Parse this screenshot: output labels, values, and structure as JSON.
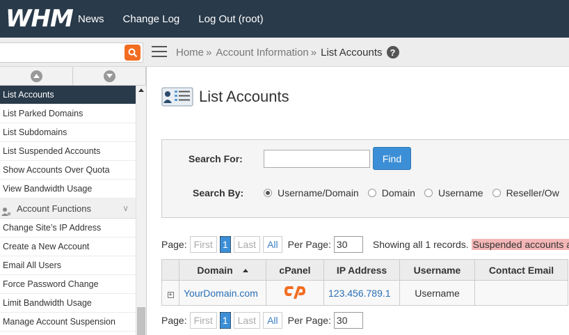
{
  "topbar": {
    "logo": "WHM",
    "nav": [
      "News",
      "Change Log",
      "Log Out (root)"
    ]
  },
  "subbar": {
    "search_value": "",
    "breadcrumb": [
      "Home",
      "Account Information",
      "List Accounts"
    ],
    "help": "?"
  },
  "sidebar": {
    "items_top": [
      "List Accounts",
      "List Parked Domains",
      "List Subdomains",
      "List Suspended Accounts",
      "Show Accounts Over Quota",
      "View Bandwidth Usage"
    ],
    "group_label": "Account Functions",
    "items_bottom": [
      "Change Site’s IP Address",
      "Create a New Account",
      "Email All Users",
      "Force Password Change",
      "Limit Bandwidth Usage",
      "Manage Account Suspension"
    ]
  },
  "main": {
    "title": "List Accounts",
    "search": {
      "label_for": "Search For:",
      "label_by": "Search By:",
      "value": "",
      "find_label": "Find",
      "options": [
        "Username/Domain",
        "Domain",
        "Username",
        "Reseller/Ow"
      ]
    },
    "pager": {
      "page_label": "Page:",
      "first": "First",
      "current": "1",
      "last": "Last",
      "all": "All",
      "per_page_label": "Per Page:",
      "per_page_value": "30",
      "showing": "Showing all 1 records.",
      "suspended": "Suspended accounts a"
    },
    "table": {
      "headers": [
        "Domain",
        "cPanel",
        "IP Address",
        "Username",
        "Contact Email"
      ],
      "rows": [
        {
          "expand": "+",
          "domain": "YourDomain.com",
          "cpanel": "cP",
          "ip": "123.456.789.1",
          "username": "Username",
          "email": ""
        }
      ]
    }
  },
  "colors": {
    "topbar": "#293a4a",
    "accent_orange": "#f26d21",
    "link_blue": "#2a6fb5",
    "button_blue": "#3c8fd6",
    "suspended_bg": "#f4b6b6"
  }
}
